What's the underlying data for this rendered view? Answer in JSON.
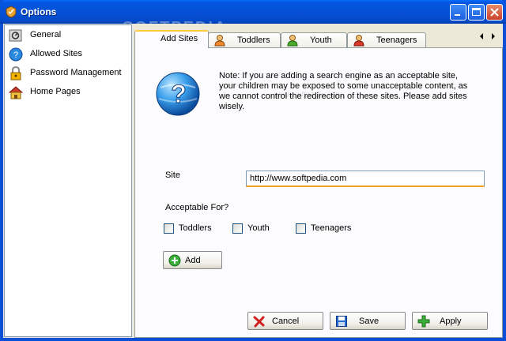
{
  "window": {
    "title": "Options",
    "watermark": "SOFTPEDIA",
    "watermark_url": "www.softpedia.com"
  },
  "sidebar": {
    "items": [
      {
        "label": "General",
        "icon": "general-settings-icon"
      },
      {
        "label": "Allowed Sites",
        "icon": "allowed-sites-icon"
      },
      {
        "label": "Password Management",
        "icon": "password-lock-icon"
      },
      {
        "label": "Home Pages",
        "icon": "home-icon"
      }
    ]
  },
  "tabs": [
    {
      "label": "Add Sites",
      "active": true
    },
    {
      "label": "Toddlers",
      "icon": "person-icon"
    },
    {
      "label": "Youth",
      "icon": "person-icon"
    },
    {
      "label": "Teenagers",
      "icon": "person-icon"
    }
  ],
  "main": {
    "note": "Note: If you are adding a search engine as an acceptable site, your children may be exposed to some unacceptable content, as we cannot control the redirection of these sites. Please add sites wisely.",
    "site_label": "Site",
    "site_value": "http://www.softpedia.com",
    "acceptable_label": "Acceptable For?",
    "checkboxes": [
      {
        "label": "Toddlers",
        "checked": false
      },
      {
        "label": "Youth",
        "checked": false
      },
      {
        "label": "Teenagers",
        "checked": false
      }
    ],
    "add_label": "Add"
  },
  "footer": {
    "cancel_label": "Cancel",
    "save_label": "Save",
    "apply_label": "Apply"
  },
  "colors": {
    "titlebar": "#0551d6",
    "tab_highlight": "#ffc73c",
    "input_focus": "#f0a020"
  }
}
